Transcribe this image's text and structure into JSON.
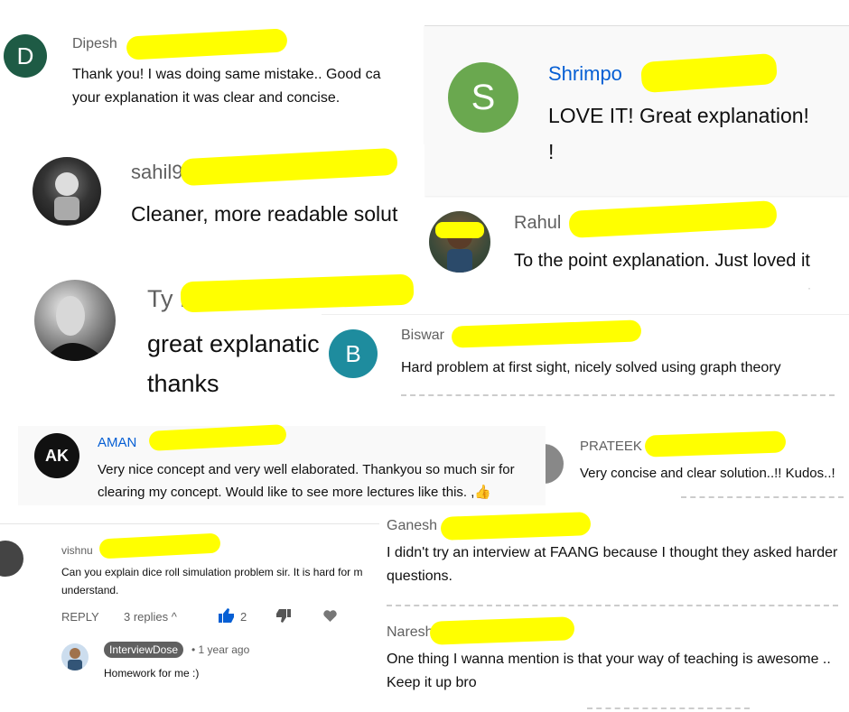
{
  "comments": {
    "dipesh": {
      "avatar_letter": "D",
      "author": "Dipesh",
      "text_line1": "Thank you!  I was doing same mistake.. Good ca",
      "text_line2": "your explanation it was clear and concise.",
      "avatar_color": "#1e5b45"
    },
    "shrimpo": {
      "avatar_letter": "S",
      "author": "Shrimpo",
      "text_line1": "LOVE IT! Great explanation!",
      "text_line2": "!",
      "avatar_color": "#6aa84f"
    },
    "sahil": {
      "author": "sahil9",
      "text": "Cleaner, more readable solut"
    },
    "rahul": {
      "author": "Rahul",
      "text": "To the point explanation. Just loved it"
    },
    "ty": {
      "author": "Ty L",
      "text_line1": "great explanatic",
      "text_line2": "thanks"
    },
    "biswa": {
      "avatar_letter": "B",
      "author": "Biswar",
      "text": "Hard problem at first sight, nicely solved using graph theory",
      "avatar_color": "#1e8c9e"
    },
    "aman": {
      "avatar_text": "AK",
      "author": "AMAN",
      "text_line1": "Very nice concept and very well elaborated. Thankyou so much sir for",
      "text_line2": "clearing my concept. Would like to see more lectures like this. ,👍"
    },
    "prateek": {
      "author": "PRATEEK",
      "text": "Very concise and clear solution..!! Kudos..!"
    },
    "vishnu": {
      "author": "vishnu",
      "text_line1": "Can you explain dice roll simulation problem sir. It is hard for m",
      "text_line2": "understand.",
      "reply_label": "REPLY",
      "replies_label": "3 replies",
      "like_count": "2"
    },
    "reply": {
      "author_badge": "InterviewDose",
      "time": "1 year ago",
      "text": "Homework for me :)"
    },
    "ganesh": {
      "author": "Ganesh",
      "text_line1": "I didn't try an interview at FAANG because I thought they asked harder",
      "text_line2": "questions."
    },
    "naresh": {
      "author": "Naresh",
      "text_line1": "One thing I wanna mention is that your way of teaching is awesome ..",
      "text_line2": "Keep it up bro"
    }
  },
  "highlight_color": "#ffff00"
}
